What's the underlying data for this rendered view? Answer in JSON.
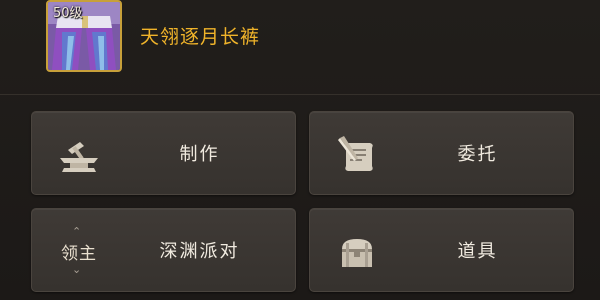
{
  "item": {
    "level": "50级",
    "name": "天翎逐月长裤",
    "icon": "purple-trousers-icon",
    "name_color": "#f0b42a",
    "frame_color": "#c7a03a"
  },
  "buttons": [
    {
      "label": "制作",
      "icon": "anvil-hammer-icon"
    },
    {
      "label": "委托",
      "icon": "scroll-quill-icon"
    },
    {
      "label": "深渊派对",
      "icon": "lord-badge-icon",
      "icon_text": "领主"
    },
    {
      "label": "道具",
      "icon": "treasure-chest-icon"
    }
  ]
}
